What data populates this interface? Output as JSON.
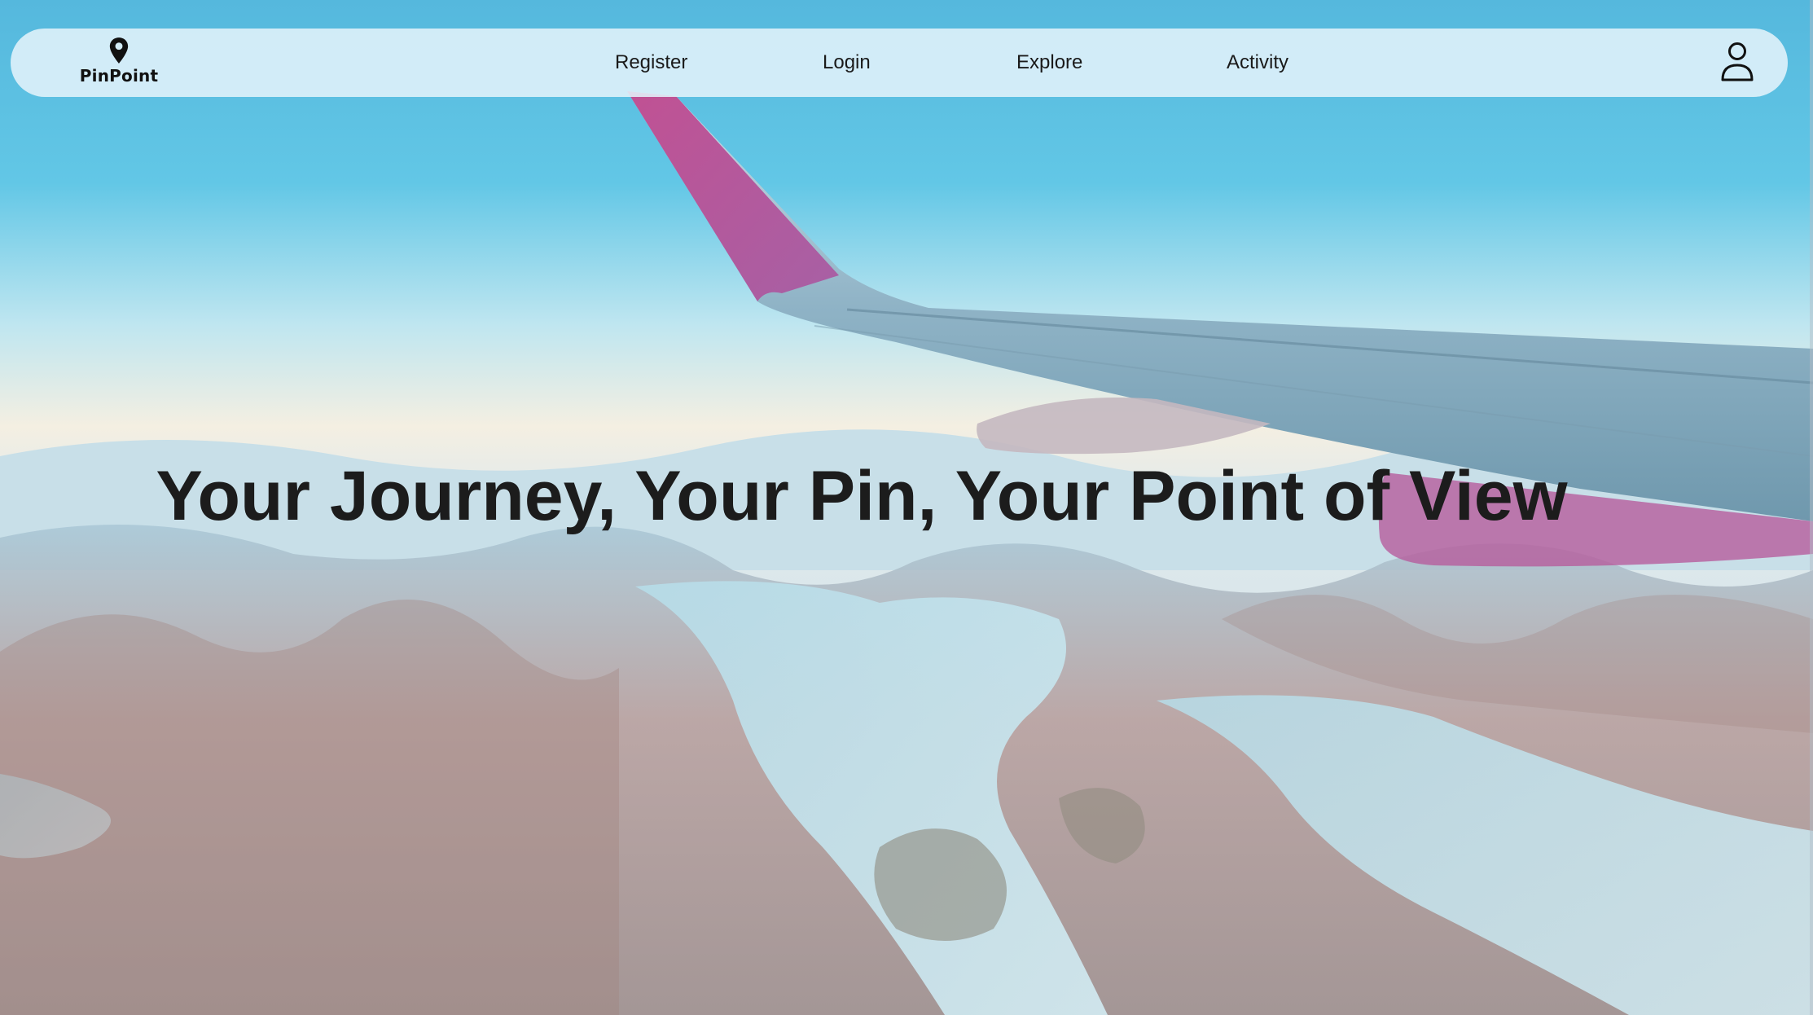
{
  "brand": {
    "name": "PinPoint",
    "logo_icon": "map-pin-icon"
  },
  "nav": {
    "items": [
      {
        "label": "Register"
      },
      {
        "label": "Login"
      },
      {
        "label": "Explore"
      },
      {
        "label": "Activity"
      }
    ],
    "profile_icon": "user-icon"
  },
  "hero": {
    "title": "Your Journey, Your Pin, Your Point of View"
  },
  "colors": {
    "navbar_bg": "#e2f3fa",
    "text": "#1a1a1a",
    "wing_accent": "#b5509a"
  }
}
